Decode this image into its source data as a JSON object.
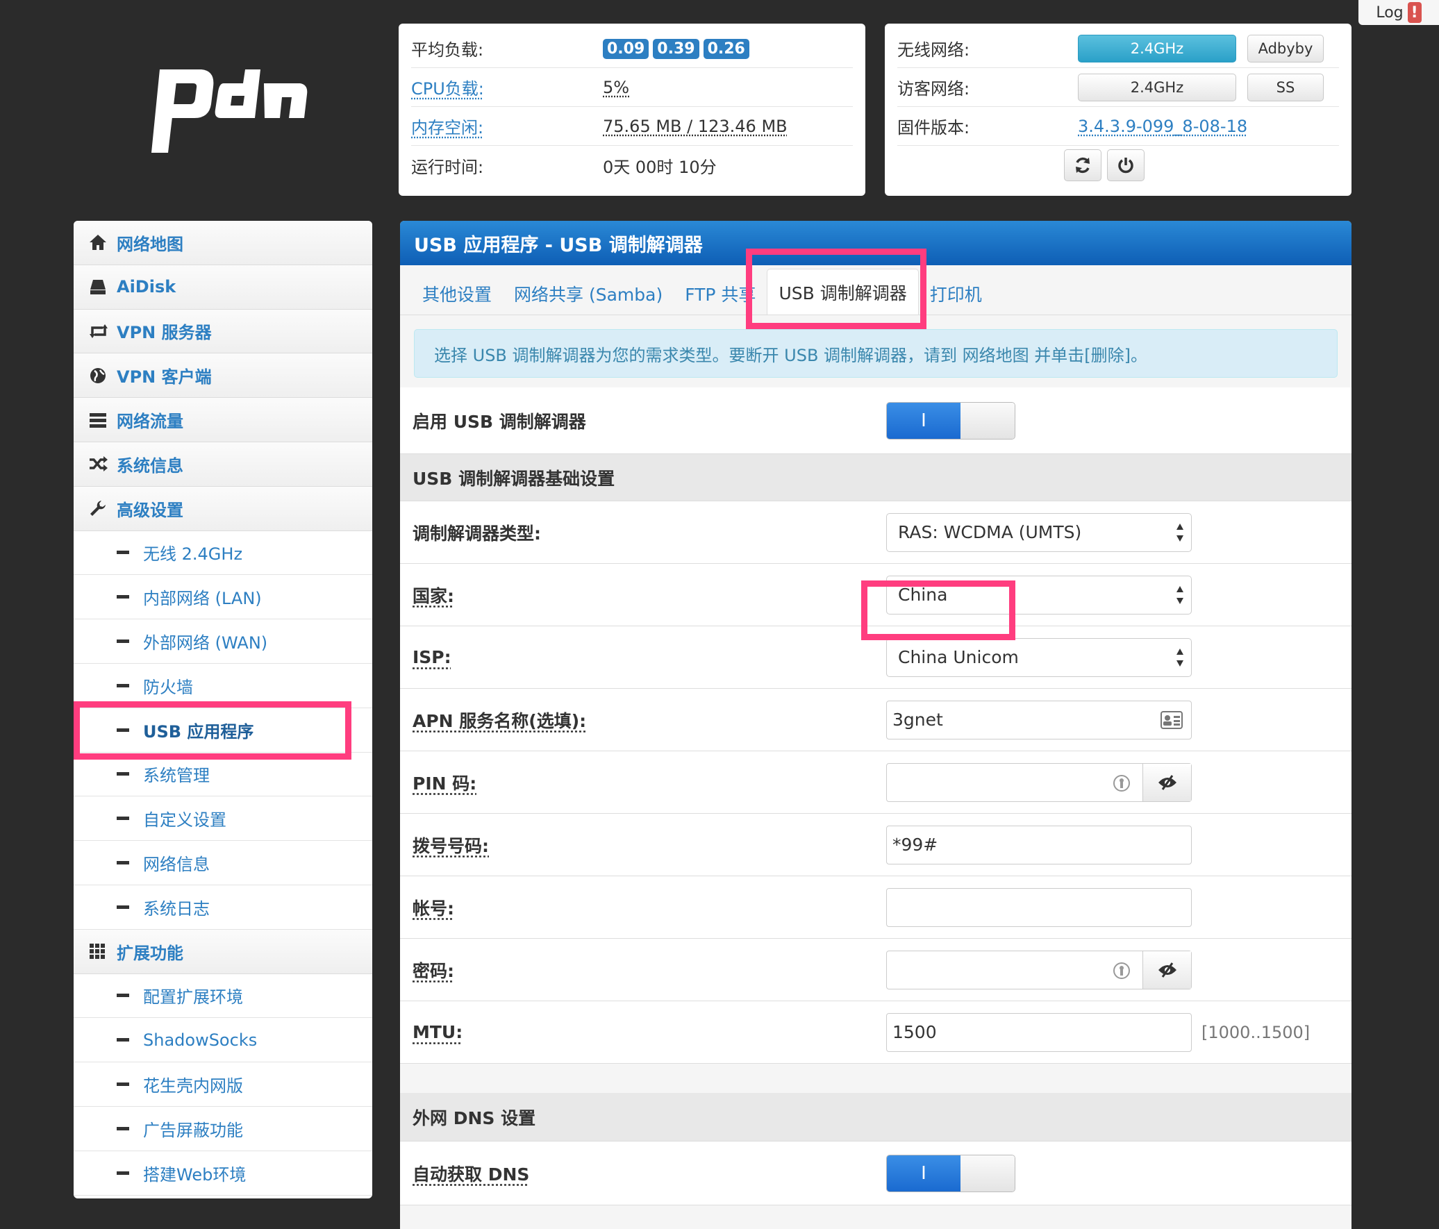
{
  "log": {
    "label": "Log",
    "badge": "!"
  },
  "status": {
    "avg_load_label": "平均负载:",
    "load": [
      "0.09",
      "0.39",
      "0.26"
    ],
    "cpu_label": "CPU负载:",
    "cpu_value": "5%",
    "mem_label": "内存空闲:",
    "mem_value": "75.65 MB / 123.46 MB",
    "uptime_label": "运行时间:",
    "uptime_value": "0天 00时 10分"
  },
  "network": {
    "wireless_label": "无线网络:",
    "wireless_btn": "2.4GHz",
    "adbyby_btn": "Adbyby",
    "guest_label": "访客网络:",
    "guest_btn": "2.4GHz",
    "ss_btn": "SS",
    "fw_label": "固件版本:",
    "fw_value": "3.4.3.9-099_8-08-18"
  },
  "sidebar": {
    "items": [
      {
        "label": "网络地图",
        "icon": "home-icon"
      },
      {
        "label": "AiDisk",
        "icon": "hdd-icon"
      },
      {
        "label": "VPN 服务器",
        "icon": "retweet-icon"
      },
      {
        "label": "VPN 客户端",
        "icon": "globe-icon"
      },
      {
        "label": "网络流量",
        "icon": "tasks-icon"
      },
      {
        "label": "系统信息",
        "icon": "random-icon"
      },
      {
        "label": "高级设置",
        "icon": "wrench-icon"
      }
    ],
    "advanced": [
      "无线 2.4GHz",
      "内部网络 (LAN)",
      "外部网络 (WAN)",
      "防火墙",
      "USB 应用程序",
      "系统管理",
      "自定义设置",
      "网络信息",
      "系统日志"
    ],
    "ext_label": "扩展功能",
    "ext": [
      "配置扩展环境",
      "ShadowSocks",
      "花生壳内网版",
      "广告屏蔽功能",
      "搭建Web环境"
    ]
  },
  "main": {
    "title": "USB 应用程序 - USB 调制解调器",
    "tabs": [
      "其他设置",
      "网络共享 (Samba)",
      "FTP 共享",
      "USB 调制解调器",
      "打印机"
    ],
    "alert": "选择 USB 调制解调器为您的需求类型。要断开 USB 调制解调器，请到 网络地图 并单击[删除]。",
    "enable_label": "启用 USB 调制解调器",
    "toggle_on": "I",
    "section_basic": "USB 调制解调器基础设置",
    "modem_type_label": "调制解调器类型:",
    "modem_type_value": "RAS: WCDMA (UMTS)",
    "country_label": "国家:",
    "country_value": "China",
    "isp_label": "ISP:",
    "isp_value": "China Unicom",
    "apn_label": "APN 服务名称(选填):",
    "apn_value": "3gnet",
    "pin_label": "PIN 码:",
    "pin_value": "",
    "dial_label": "拨号号码:",
    "dial_value": "*99#",
    "account_label": "帐号:",
    "account_value": "",
    "password_label": "密码:",
    "password_value": "",
    "mtu_label": "MTU:",
    "mtu_value": "1500",
    "mtu_hint": "[1000..1500]",
    "section_dns": "外网 DNS 设置",
    "auto_dns_label": "自动获取 DNS"
  },
  "colors": {
    "accent": "#2d7fc2",
    "header": "#1a6ad0",
    "highlight": "#ff3d7f",
    "background": "#2b2b2b"
  }
}
